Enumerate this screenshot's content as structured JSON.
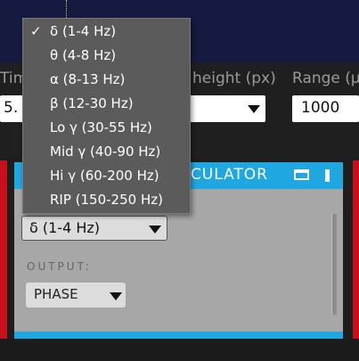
{
  "controls": {
    "time_label_partial": "Tim",
    "height_label": "height (px)",
    "range_label_partial": "Range (µ",
    "time_value_partial": "5.",
    "range_value": "1000"
  },
  "module": {
    "title_partial": "CULATOR",
    "band_select_value": "δ (1-4 Hz)",
    "output_label": "OUTPUT:",
    "output_value": "PHASE"
  },
  "band_menu": {
    "selected_index": 0,
    "check_glyph": "✓",
    "items": [
      "δ (1-4 Hz)",
      "θ (4-8 Hz)",
      "α (8-13 Hz)",
      "β (12-30 Hz)",
      "Lo γ (30-55 Hz)",
      "Mid γ (40-90 Hz)",
      "Hi γ (60-200 Hz)",
      "RIP  (150-250 Hz)"
    ]
  },
  "icons": {
    "window": "window-icon",
    "pin": "pin-icon",
    "caret": "chevron-down-icon"
  },
  "colors": {
    "accent": "#1fa7e2",
    "edge_red": "#c8101d",
    "menu_bg": "#5b5b5b",
    "top_strip": "#151a40"
  }
}
